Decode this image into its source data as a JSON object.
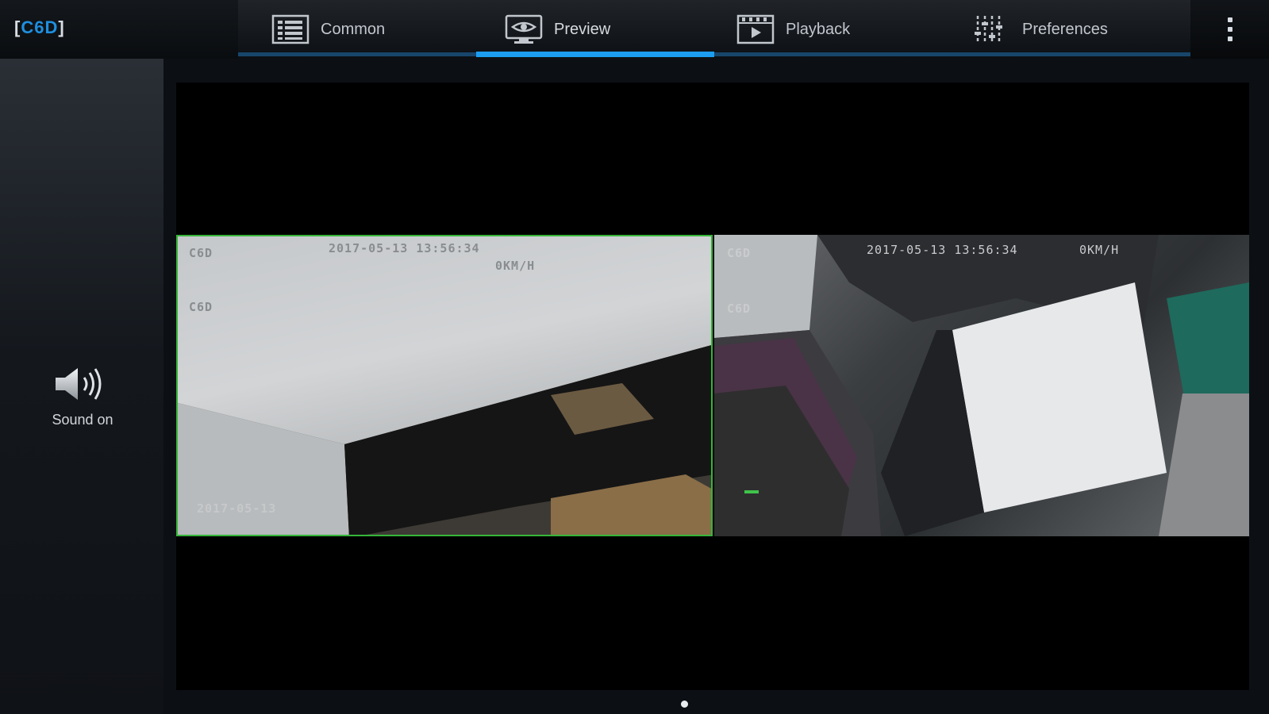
{
  "app": {
    "logo_text": "C6D"
  },
  "tabs": [
    {
      "label": "Common",
      "icon": "list-grid-icon",
      "active": false
    },
    {
      "label": "Preview",
      "icon": "eye-monitor-icon",
      "active": true
    },
    {
      "label": "Playback",
      "icon": "film-play-icon",
      "active": false
    },
    {
      "label": "Preferences",
      "icon": "sliders-icon",
      "active": false
    }
  ],
  "sidebar": {
    "sound_label": "Sound on",
    "sound_icon": "speaker-icon"
  },
  "cameras": [
    {
      "channel_label": "C6D",
      "channel_label_2": "C6D",
      "timestamp": "2017-05-13 13:56:34",
      "speed": "0KM/H",
      "bottom_text": "2017-05-13",
      "selected": true
    },
    {
      "channel_label": "C6D",
      "channel_label_2": "C6D",
      "timestamp": "2017-05-13 13:56:34",
      "speed": "0KM/H",
      "selected": false
    }
  ],
  "colors": {
    "accent": "#1c9df0",
    "selected_border": "#36b53a",
    "logo_brand": "#1e8fe0"
  },
  "pager": {
    "current": 1,
    "total": 1
  }
}
